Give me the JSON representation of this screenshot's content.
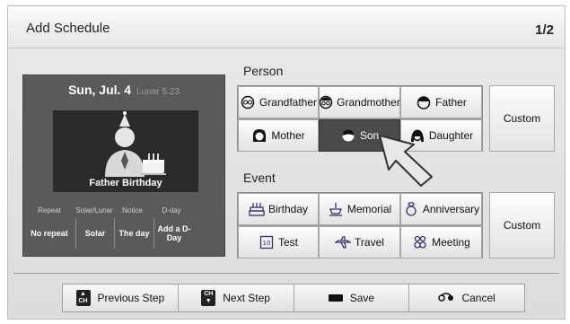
{
  "header": {
    "title": "Add Schedule",
    "page_indicator": "1/2"
  },
  "preview": {
    "date": "Sun, Jul. 4",
    "lunar": "Lunar 5.23",
    "caption": "Father Birthday",
    "columns": [
      {
        "label": "Repeat",
        "value": "No repeat"
      },
      {
        "label": "Solar/Lunar",
        "value": "Solar"
      },
      {
        "label": "Notice",
        "value": "The day"
      },
      {
        "label": "D-day",
        "value": "Add a D-Day"
      }
    ]
  },
  "person": {
    "heading": "Person",
    "options": [
      "Grandfather",
      "Grandmother",
      "Father",
      "Mother",
      "Son",
      "Daughter"
    ],
    "selected": "Son",
    "custom_label": "Custom"
  },
  "event": {
    "heading": "Event",
    "options": [
      "Birthday",
      "Memorial",
      "Anniversary",
      "Test",
      "Travel",
      "Meeting"
    ],
    "custom_label": "Custom"
  },
  "footer": {
    "prev_label": "Previous Step",
    "next_label": "Next Step",
    "save_label": "Save",
    "cancel_label": "Cancel",
    "key_ch": "CH"
  }
}
